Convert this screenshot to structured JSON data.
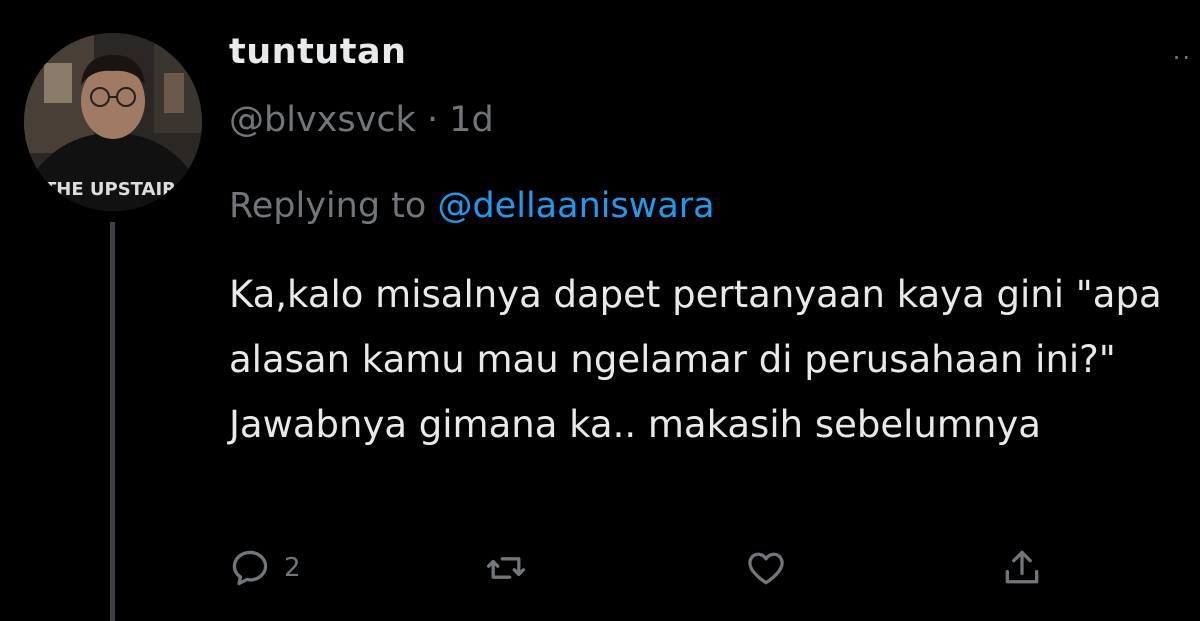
{
  "tweet": {
    "display_name": "tuntutan",
    "handle": "@blvxsvck",
    "separator": "·",
    "time": "1d",
    "replying_prefix": "Replying to",
    "replying_mention": "@dellaaniswara",
    "text": "Ka,kalo misalnya dapet pertanyaan kaya gini \"apa alasan kamu mau ngelamar di perusahaan ini?\" Jawabnya gimana ka.. makasih sebelumnya",
    "shirt_text": "THE UPSTAIRS"
  },
  "actions": {
    "reply_count": "2",
    "retweet_count": "",
    "like_count": "",
    "icons": [
      "reply-icon",
      "retweet-icon",
      "like-icon",
      "share-icon"
    ]
  },
  "colors": {
    "background": "#000000",
    "text": "#e7e9ea",
    "secondary": "#71767b",
    "link": "#1d9bf0"
  }
}
